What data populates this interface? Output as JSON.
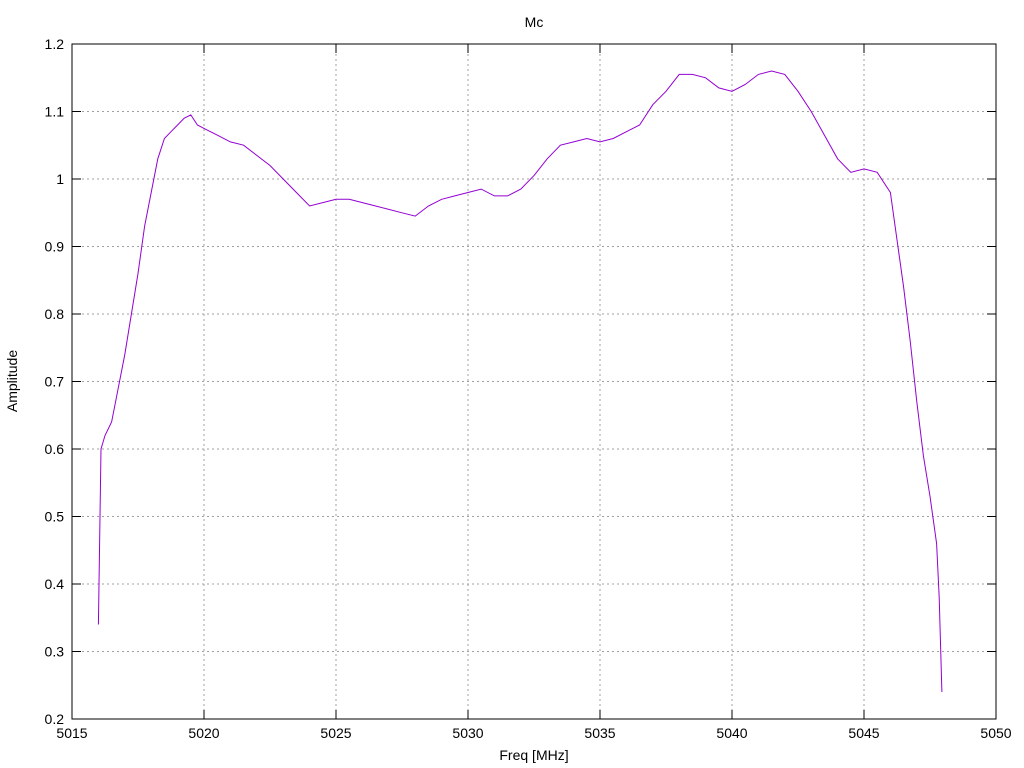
{
  "chart_data": {
    "type": "line",
    "title": "Mc",
    "xlabel": "Freq [MHz]",
    "ylabel": "Amplitude",
    "xlim": [
      5015,
      5050
    ],
    "ylim": [
      0.2,
      1.2
    ],
    "xticks": [
      5015,
      5020,
      5025,
      5030,
      5035,
      5040,
      5045,
      5050
    ],
    "yticks": [
      0.2,
      0.3,
      0.4,
      0.5,
      0.6,
      0.7,
      0.8,
      0.9,
      1,
      1.1,
      1.2
    ],
    "grid": true,
    "legend": "none",
    "series": [
      {
        "name": "Mc",
        "color": "#9400d3",
        "x": [
          5016,
          5016.1,
          5016.25,
          5016.5,
          5016.75,
          5017,
          5017.25,
          5017.5,
          5017.75,
          5018,
          5018.25,
          5018.5,
          5018.75,
          5019,
          5019.25,
          5019.5,
          5019.75,
          5020,
          5020.5,
          5021,
          5021.5,
          5022,
          5022.5,
          5023,
          5023.5,
          5024,
          5024.5,
          5025,
          5025.5,
          5026,
          5026.5,
          5027,
          5027.5,
          5028,
          5028.5,
          5029,
          5029.5,
          5030,
          5030.5,
          5031,
          5031.5,
          5032,
          5032.5,
          5033,
          5033.5,
          5034,
          5034.5,
          5035,
          5035.5,
          5036,
          5036.5,
          5037,
          5037.5,
          5038,
          5038.5,
          5039,
          5039.5,
          5040,
          5040.5,
          5041,
          5041.5,
          5042,
          5042.5,
          5043,
          5043.5,
          5044,
          5044.5,
          5045,
          5045.5,
          5046,
          5046.25,
          5046.5,
          5046.75,
          5047,
          5047.25,
          5047.5,
          5047.75,
          5047.85,
          5047.95
        ],
        "y": [
          0.34,
          0.6,
          0.62,
          0.64,
          0.69,
          0.74,
          0.8,
          0.86,
          0.93,
          0.98,
          1.03,
          1.06,
          1.07,
          1.08,
          1.09,
          1.095,
          1.08,
          1.075,
          1.065,
          1.055,
          1.05,
          1.035,
          1.02,
          1.0,
          0.98,
          0.96,
          0.965,
          0.97,
          0.97,
          0.965,
          0.96,
          0.955,
          0.95,
          0.945,
          0.96,
          0.97,
          0.975,
          0.98,
          0.985,
          0.975,
          0.975,
          0.985,
          1.005,
          1.03,
          1.05,
          1.055,
          1.06,
          1.055,
          1.06,
          1.07,
          1.08,
          1.11,
          1.13,
          1.155,
          1.155,
          1.15,
          1.135,
          1.13,
          1.14,
          1.155,
          1.16,
          1.155,
          1.13,
          1.1,
          1.065,
          1.03,
          1.01,
          1.015,
          1.01,
          0.98,
          0.91,
          0.84,
          0.76,
          0.67,
          0.59,
          0.53,
          0.46,
          0.38,
          0.24
        ]
      }
    ]
  }
}
